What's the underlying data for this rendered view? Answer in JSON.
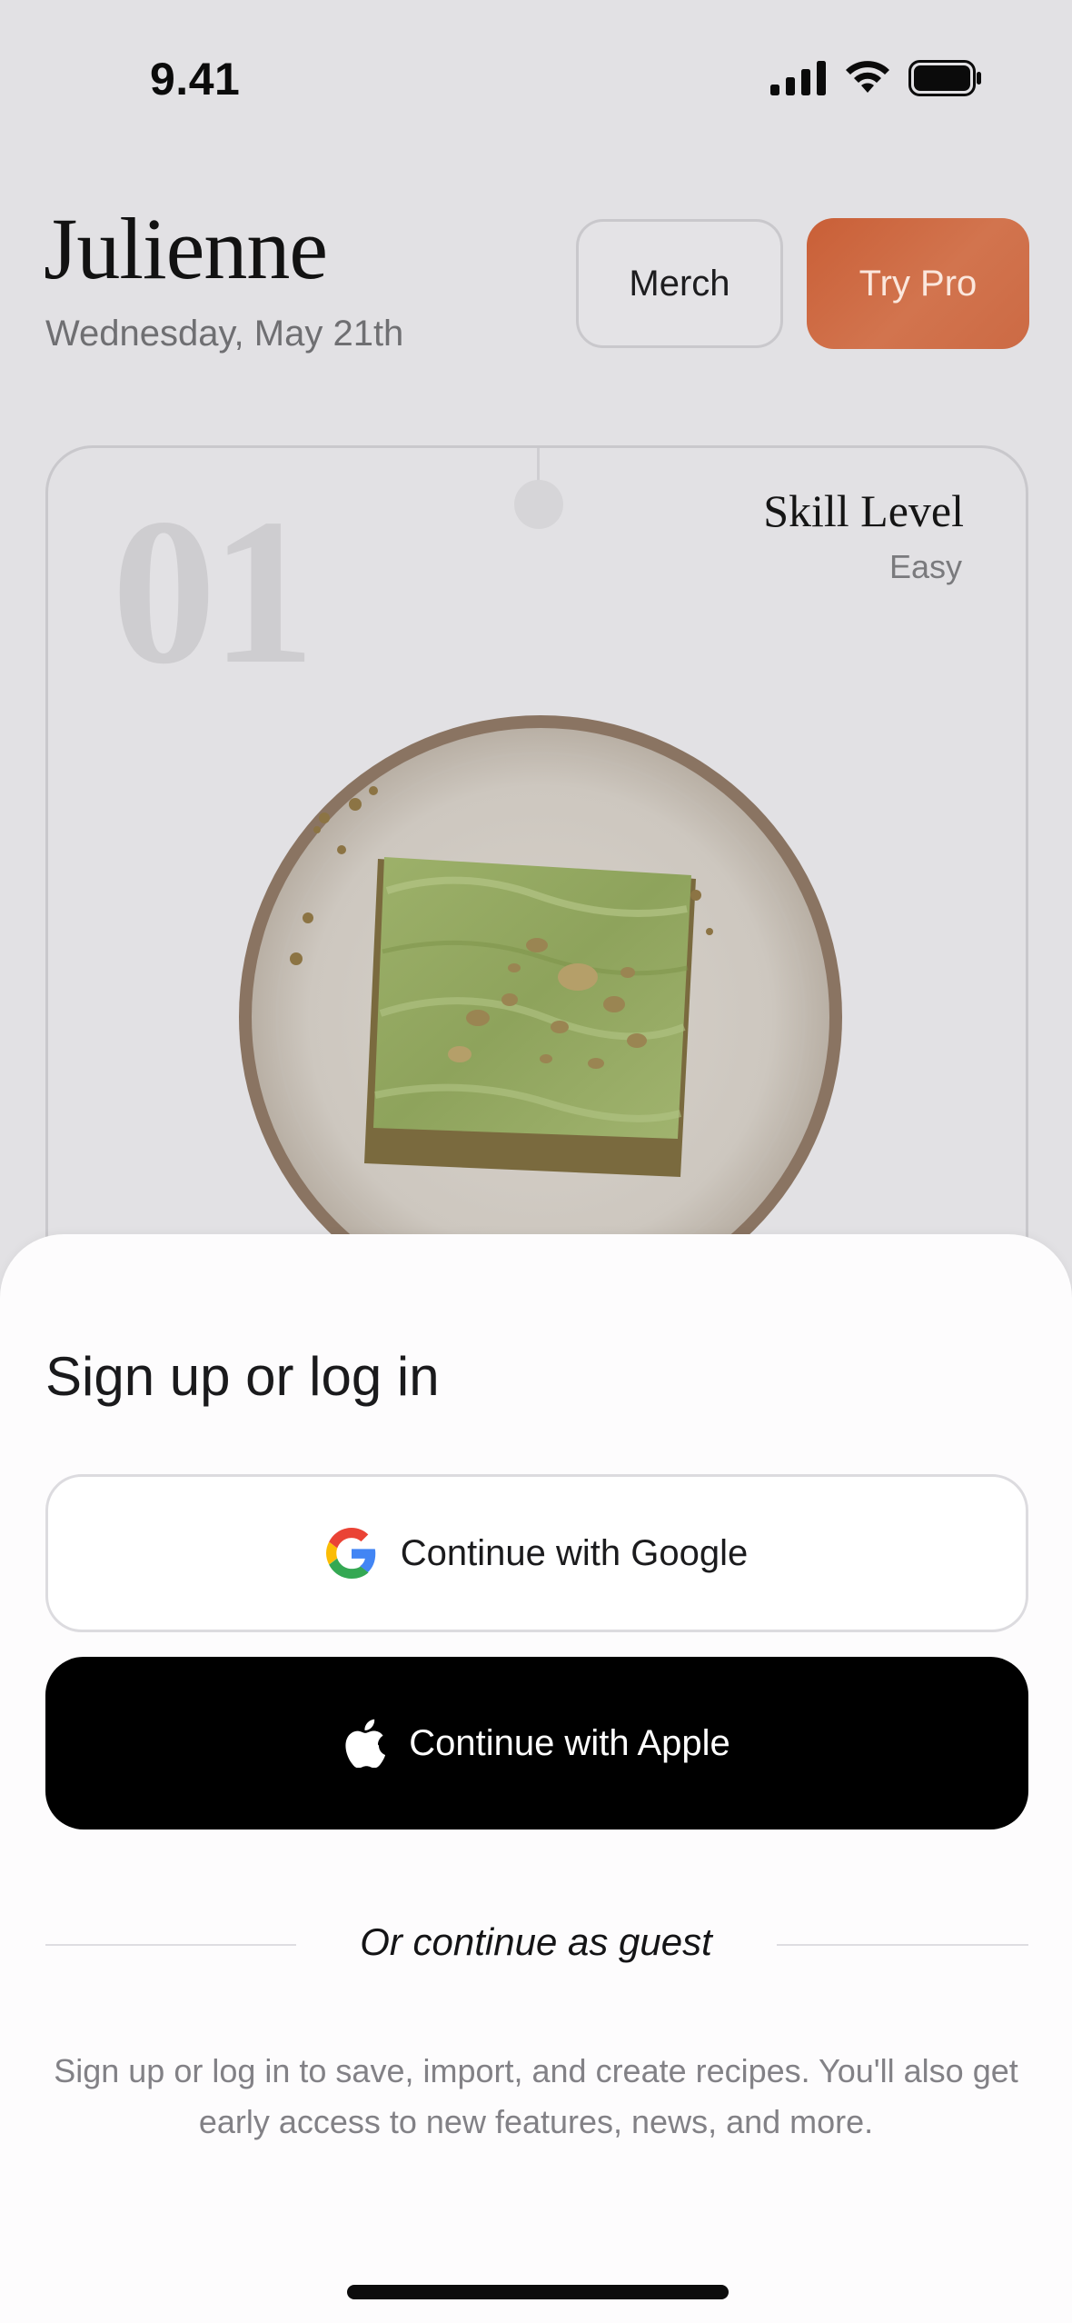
{
  "status_bar": {
    "time": "9.41",
    "icons": [
      "cellular-signal-icon",
      "wifi-icon",
      "battery-icon"
    ]
  },
  "header": {
    "title": "Julienne",
    "date": "Wednesday, May 21th",
    "merch_label": "Merch",
    "pro_label": "Try Pro"
  },
  "recipe_card": {
    "number": "01",
    "skill_label": "Skill Level",
    "skill_value": "Easy",
    "image": "matcha-pistachio-bar-on-plate"
  },
  "auth_sheet": {
    "title": "Sign up or log in",
    "google_label": "Continue with Google",
    "apple_label": "Continue with Apple",
    "guest_label": "Or continue as guest",
    "info": "Sign up or log in to save, import, and create recipes. You'll also get early access to new features, news, and more."
  },
  "colors": {
    "background": "#e2e1e4",
    "accent_pro": "#c95f37",
    "sheet": "#fdfcfd",
    "apple_button": "#000000"
  }
}
